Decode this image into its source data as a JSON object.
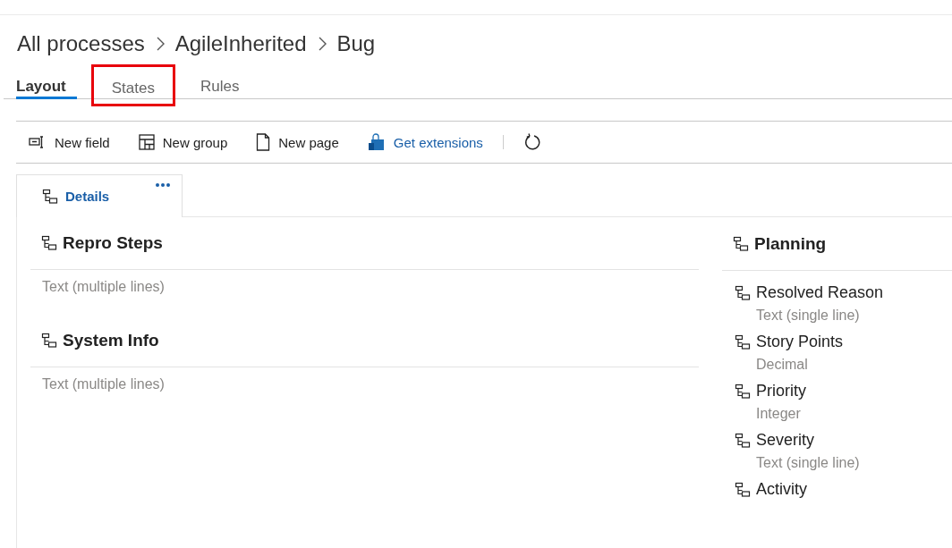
{
  "breadcrumb": [
    "All processes",
    "AgileInherited",
    "Bug"
  ],
  "tabs": [
    {
      "label": "Layout",
      "selected": true,
      "highlighted": false
    },
    {
      "label": "States",
      "selected": false,
      "highlighted": true
    },
    {
      "label": "Rules",
      "selected": false,
      "highlighted": false
    }
  ],
  "toolbar": [
    {
      "kind": "field",
      "label": "New field"
    },
    {
      "kind": "group",
      "label": "New group"
    },
    {
      "kind": "page",
      "label": "New page"
    },
    {
      "kind": "extensions",
      "label": "Get extensions"
    },
    {
      "kind": "refresh"
    }
  ],
  "page_tabs": [
    {
      "label": "Details",
      "selected": true
    }
  ],
  "left_groups": [
    {
      "title": "Repro Steps",
      "fields": [
        {
          "type": "Text (multiple lines)"
        }
      ]
    },
    {
      "title": "System Info",
      "fields": [
        {
          "type": "Text (multiple lines)"
        }
      ]
    }
  ],
  "right_groups": [
    {
      "title": "Planning",
      "fields": [
        {
          "label": "Resolved Reason",
          "type": "Text (single line)"
        },
        {
          "label": "Story Points",
          "type": "Decimal"
        },
        {
          "label": "Priority",
          "type": "Integer"
        },
        {
          "label": "Severity",
          "type": "Text (single line)"
        },
        {
          "label": "Activity"
        }
      ]
    }
  ]
}
